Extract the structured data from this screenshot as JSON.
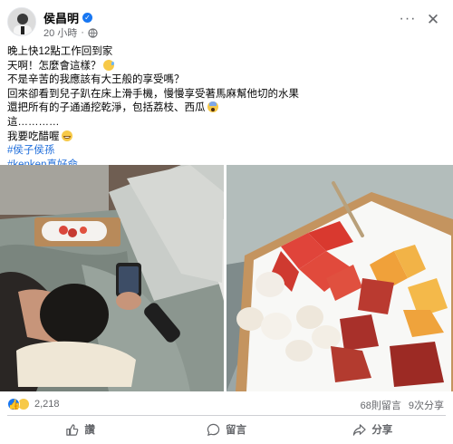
{
  "post": {
    "author": "侯昌明",
    "time": "20 小時",
    "privacy_separator": "·",
    "more_label": "···",
    "close_label": "✕",
    "lines": [
      "晚上快12點工作回到家",
      "天啊！怎麼會這樣？",
      "不是辛苦的我應該有大王般的享受嗎？",
      "回來卻看到兒子趴在床上滑手機，慢慢享受著馬麻幫他切的水果",
      "還把所有的子通通挖乾淨，包括荔枝、西瓜",
      "這…………",
      "我要吃醋喔"
    ],
    "hashtags": [
      "#侯子侯孫",
      "#kenken真好命"
    ]
  },
  "stats": {
    "reaction_count": "2,218",
    "comments": "68則留言",
    "shares": "9次分享"
  },
  "actions": {
    "like": "讚",
    "comment": "留言",
    "share": "分享"
  },
  "icons": {
    "verified": "verified-badge-icon",
    "globe": "globe-icon",
    "like": "thumbs-up-icon",
    "comment": "comment-bubble-icon",
    "share": "share-arrow-icon"
  },
  "colors": {
    "accent": "#1877f2",
    "hashtag": "#216fdb",
    "secondary_text": "#65676b"
  }
}
